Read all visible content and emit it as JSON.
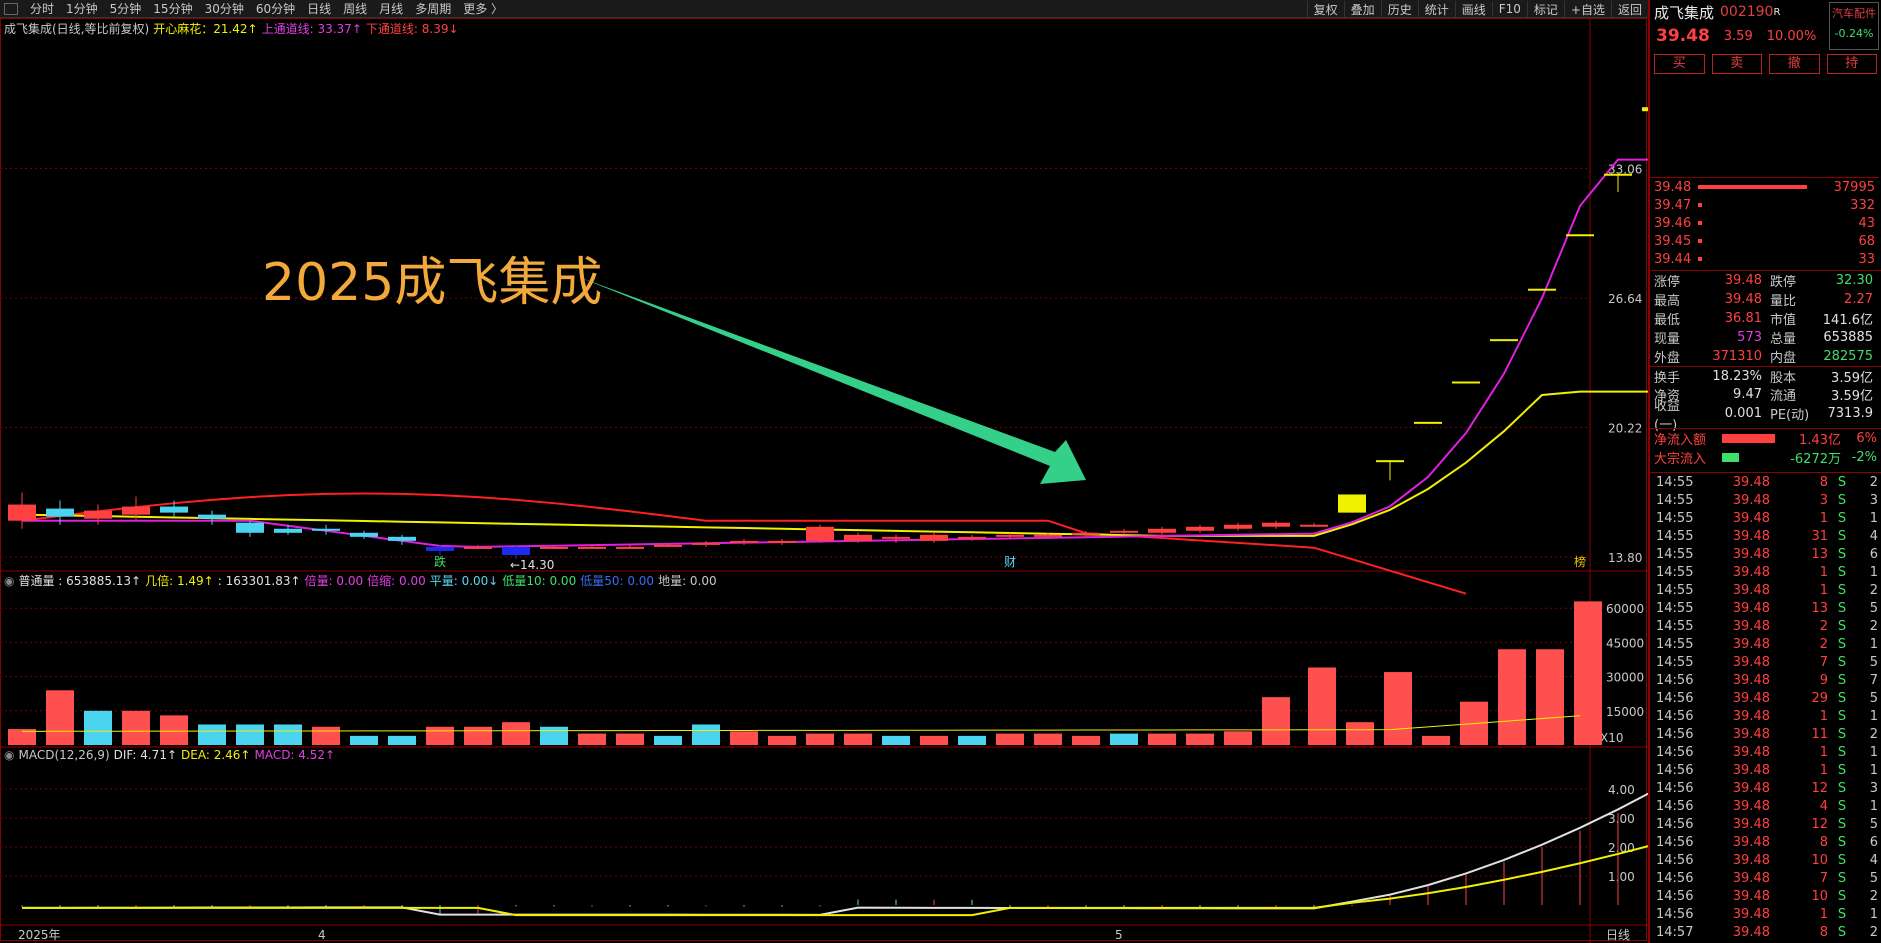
{
  "toolbar": {
    "periods": [
      "分时",
      "1分钟",
      "5分钟",
      "15分钟",
      "30分钟",
      "60分钟",
      "日线",
      "周线",
      "月线",
      "多周期",
      "更多 〉"
    ],
    "actions": [
      "复权",
      "叠加",
      "历史",
      "统计",
      "画线",
      "F10",
      "标记",
      "+自选",
      "返回"
    ]
  },
  "main_legend": {
    "title": "成飞集成(日线,等比前复权)",
    "ind": "开心麻花：21.42↑",
    "upper": "上通道线: 33.37↑",
    "lower": "下通道线: 8.39↓"
  },
  "annotation": "2025成飞集成",
  "price_labels": {
    "high": "39.48",
    "low": "←14.30",
    "markers": [
      "跌",
      "财",
      "榜"
    ]
  },
  "price_axis": [
    "33.06",
    "26.64",
    "20.22",
    "13.80"
  ],
  "vol_legend": {
    "items": [
      {
        "t": "普通量 : 653885.13↑",
        "c": "#e0e0e0"
      },
      {
        "t": "几倍: 1.49↑",
        "c": "#f0f000"
      },
      {
        "t": ": 163301.83↑",
        "c": "#e0e0e0"
      },
      {
        "t": "倍量: 0.00",
        "c": "#e040e0"
      },
      {
        "t": "倍缩: 0.00",
        "c": "#e040e0"
      },
      {
        "t": "平量: 0.00↓",
        "c": "#5ad7f0"
      },
      {
        "t": "低量10: 0.00",
        "c": "#3ee06a"
      },
      {
        "t": "低量50: 0.00",
        "c": "#3a6cf0"
      },
      {
        "t": "地量: 0.00",
        "c": "#c8c8c8"
      }
    ]
  },
  "vol_axis": [
    "60000",
    "45000",
    "30000",
    "15000"
  ],
  "vol_unit": "X10",
  "macd_legend": {
    "items": [
      {
        "t": "MACD(12,26,9)",
        "c": "#c8c8c8"
      },
      {
        "t": "DIF: 4.71↑",
        "c": "#e0e0e0"
      },
      {
        "t": "DEA: 2.46↑",
        "c": "#f0f000"
      },
      {
        "t": "MACD: 4.52↑",
        "c": "#e040e0"
      }
    ]
  },
  "macd_axis": [
    "4.00",
    "3.00",
    "2.00",
    "1.00"
  ],
  "date_axis": {
    "start": "2025年",
    "m4": "4",
    "m5": "5",
    "period": "日线"
  },
  "quote": {
    "name": "成飞集成",
    "code": "002190",
    "badge": "R",
    "price": "39.48",
    "change": "3.59",
    "pct": "10.00%",
    "sector": "汽车配件",
    "sector_pct": "-0.24%"
  },
  "trade_buttons": [
    "买",
    "卖",
    "撤",
    "持"
  ],
  "order_book": [
    {
      "p": "39.48",
      "v": "37995",
      "w": 0.95
    },
    {
      "p": "39.47",
      "v": "332",
      "w": 0.01
    },
    {
      "p": "39.46",
      "v": "43",
      "w": 0.01
    },
    {
      "p": "39.45",
      "v": "68",
      "w": 0.01
    },
    {
      "p": "39.44",
      "v": "33",
      "w": 0.01
    }
  ],
  "stats": [
    {
      "l": "涨停",
      "v": "39.48",
      "vc": "red",
      "l2": "跌停",
      "v2": "32.30",
      "v2c": "grn"
    },
    {
      "l": "最高",
      "v": "39.48",
      "vc": "red",
      "l2": "量比",
      "v2": "2.27",
      "v2c": "red"
    },
    {
      "l": "最低",
      "v": "36.81",
      "vc": "red",
      "l2": "市值",
      "v2": "141.6亿",
      "v2c": "wht"
    },
    {
      "l": "现量",
      "v": "573",
      "vc": "mag",
      "l2": "总量",
      "v2": "653885",
      "v2c": "wht"
    },
    {
      "l": "外盘",
      "v": "371310",
      "vc": "red",
      "l2": "内盘",
      "v2": "282575",
      "v2c": "grn"
    },
    {
      "l": "换手",
      "v": "18.23%",
      "vc": "wht",
      "l2": "股本",
      "v2": "3.59亿",
      "v2c": "wht"
    },
    {
      "l": "净资",
      "v": "9.47",
      "vc": "wht",
      "l2": "流通",
      "v2": "3.59亿",
      "v2c": "wht"
    },
    {
      "l": "收益(一)",
      "v": "0.001",
      "vc": "wht",
      "l2": "PE(动)",
      "v2": "7313.9",
      "v2c": "wht"
    }
  ],
  "flow": [
    {
      "l": "净流入额",
      "v": "1.43亿",
      "p": "6%",
      "c": "#ff4040",
      "w": 70
    },
    {
      "l": "大宗流入",
      "v": "-6272万",
      "p": "-2%",
      "c": "#3ee06a",
      "w": 22
    }
  ],
  "ticks": [
    {
      "t": "14:55",
      "p": "39.48",
      "v": "8",
      "n": "2"
    },
    {
      "t": "14:55",
      "p": "39.48",
      "v": "3",
      "n": "3"
    },
    {
      "t": "14:55",
      "p": "39.48",
      "v": "1",
      "n": "1"
    },
    {
      "t": "14:55",
      "p": "39.48",
      "v": "31",
      "n": "4"
    },
    {
      "t": "14:55",
      "p": "39.48",
      "v": "13",
      "n": "6"
    },
    {
      "t": "14:55",
      "p": "39.48",
      "v": "1",
      "n": "1"
    },
    {
      "t": "14:55",
      "p": "39.48",
      "v": "1",
      "n": "2"
    },
    {
      "t": "14:55",
      "p": "39.48",
      "v": "13",
      "n": "5"
    },
    {
      "t": "14:55",
      "p": "39.48",
      "v": "2",
      "n": "2"
    },
    {
      "t": "14:55",
      "p": "39.48",
      "v": "2",
      "n": "1"
    },
    {
      "t": "14:55",
      "p": "39.48",
      "v": "7",
      "n": "5"
    },
    {
      "t": "14:56",
      "p": "39.48",
      "v": "9",
      "n": "7"
    },
    {
      "t": "14:56",
      "p": "39.48",
      "v": "29",
      "n": "5"
    },
    {
      "t": "14:56",
      "p": "39.48",
      "v": "1",
      "n": "1"
    },
    {
      "t": "14:56",
      "p": "39.48",
      "v": "11",
      "n": "2"
    },
    {
      "t": "14:56",
      "p": "39.48",
      "v": "1",
      "n": "1"
    },
    {
      "t": "14:56",
      "p": "39.48",
      "v": "1",
      "n": "1"
    },
    {
      "t": "14:56",
      "p": "39.48",
      "v": "12",
      "n": "3"
    },
    {
      "t": "14:56",
      "p": "39.48",
      "v": "4",
      "n": "1"
    },
    {
      "t": "14:56",
      "p": "39.48",
      "v": "12",
      "n": "5"
    },
    {
      "t": "14:56",
      "p": "39.48",
      "v": "8",
      "n": "6"
    },
    {
      "t": "14:56",
      "p": "39.48",
      "v": "10",
      "n": "4"
    },
    {
      "t": "14:56",
      "p": "39.48",
      "v": "7",
      "n": "5"
    },
    {
      "t": "14:56",
      "p": "39.48",
      "v": "10",
      "n": "2"
    },
    {
      "t": "14:56",
      "p": "39.48",
      "v": "1",
      "n": "1"
    },
    {
      "t": "14:57",
      "p": "39.48",
      "v": "8",
      "n": "2"
    }
  ],
  "chart_data": [
    {
      "type": "candlestick",
      "title": "成飞集成(日线,等比前复权)",
      "y_ticks": [
        13.8,
        20.22,
        26.64,
        33.06
      ],
      "candles": [
        [
          15.6,
          16.4,
          15.2,
          17.0,
          "up"
        ],
        [
          15.8,
          16.2,
          15.4,
          16.6,
          "down"
        ],
        [
          15.7,
          16.1,
          15.4,
          16.4,
          "up"
        ],
        [
          15.9,
          16.3,
          15.6,
          16.8,
          "up"
        ],
        [
          16.0,
          16.3,
          15.8,
          16.6,
          "down"
        ],
        [
          15.7,
          15.9,
          15.4,
          16.1,
          "down"
        ],
        [
          15.5,
          15.0,
          14.8,
          15.6,
          "down"
        ],
        [
          15.2,
          15.0,
          14.9,
          15.4,
          "down"
        ],
        [
          15.2,
          15.1,
          14.9,
          15.4,
          "down"
        ],
        [
          15.0,
          14.8,
          14.7,
          15.1,
          "down"
        ],
        [
          14.8,
          14.6,
          14.4,
          14.9,
          "down"
        ],
        [
          14.3,
          14.1,
          13.9,
          14.4,
          "down"
        ],
        [
          14.3,
          14.3,
          14.2,
          14.4,
          "doji"
        ],
        [
          14.3,
          13.9,
          13.7,
          14.4,
          "down"
        ],
        [
          14.3,
          14.3,
          14.2,
          14.4,
          "doji"
        ],
        [
          14.3,
          14.3,
          14.2,
          14.4,
          "doji"
        ],
        [
          14.3,
          14.3,
          14.2,
          14.4,
          "doji"
        ],
        [
          14.4,
          14.4,
          14.3,
          14.5,
          "doji"
        ],
        [
          14.4,
          14.5,
          14.3,
          14.6,
          "up"
        ],
        [
          14.5,
          14.6,
          14.4,
          14.7,
          "up"
        ],
        [
          14.5,
          14.6,
          14.4,
          14.7,
          "up"
        ],
        [
          14.6,
          15.3,
          14.5,
          15.4,
          "up"
        ],
        [
          14.6,
          14.9,
          14.5,
          15.0,
          "up"
        ],
        [
          14.7,
          14.8,
          14.5,
          14.9,
          "up"
        ],
        [
          14.6,
          14.9,
          14.5,
          15.0,
          "up"
        ],
        [
          14.7,
          14.8,
          14.6,
          14.9,
          "up"
        ],
        [
          14.8,
          14.9,
          14.7,
          15.0,
          "up"
        ],
        [
          14.8,
          14.9,
          14.7,
          15.0,
          "up"
        ],
        [
          14.9,
          15.0,
          14.8,
          15.1,
          "up"
        ],
        [
          15.0,
          15.1,
          14.9,
          15.2,
          "up"
        ],
        [
          15.0,
          15.2,
          14.9,
          15.3,
          "up"
        ],
        [
          15.1,
          15.3,
          15.0,
          15.4,
          "up"
        ],
        [
          15.2,
          15.4,
          15.1,
          15.5,
          "up"
        ],
        [
          15.3,
          15.5,
          15.2,
          15.6,
          "up"
        ],
        [
          15.4,
          15.4,
          15.3,
          15.5,
          "doji"
        ],
        [
          16.0,
          16.9,
          16.0,
          16.9,
          "up"
        ],
        [
          18.6,
          18.6,
          17.6,
          18.6,
          "doji"
        ],
        [
          20.5,
          20.5,
          20.5,
          20.5,
          "doji"
        ],
        [
          22.5,
          22.5,
          22.5,
          22.5,
          "doji"
        ],
        [
          24.6,
          24.6,
          24.6,
          24.6,
          "doji"
        ],
        [
          27.1,
          27.1,
          27.1,
          27.1,
          "doji"
        ],
        [
          29.8,
          29.8,
          29.8,
          29.8,
          "doji"
        ],
        [
          32.8,
          32.8,
          31.9,
          32.8,
          "doji"
        ],
        [
          35.9,
          36.1,
          35.0,
          36.1,
          "up"
        ],
        [
          38.2,
          39.48,
          36.81,
          39.48,
          "up"
        ]
      ]
    },
    {
      "type": "bar",
      "title": "普通量",
      "unit": "X10",
      "y_ticks": [
        15000,
        30000,
        45000,
        60000
      ],
      "values": [
        7,
        24,
        15,
        15,
        13,
        9,
        9,
        9,
        8,
        4,
        4,
        8,
        8,
        10,
        8,
        5,
        5,
        4,
        9,
        6,
        4,
        5,
        5,
        4,
        4,
        4,
        5,
        5,
        4,
        5,
        5,
        5,
        6,
        21,
        34,
        10,
        32,
        4,
        19,
        42,
        42,
        63
      ]
    },
    {
      "type": "line",
      "title": "MACD(12,26,9)",
      "series": [
        {
          "name": "DIF",
          "values": [
            4.71
          ]
        },
        {
          "name": "DEA",
          "values": [
            2.46
          ]
        },
        {
          "name": "MACD",
          "values": [
            4.52
          ]
        }
      ],
      "y_ticks": [
        1,
        2,
        3,
        4
      ]
    }
  ]
}
